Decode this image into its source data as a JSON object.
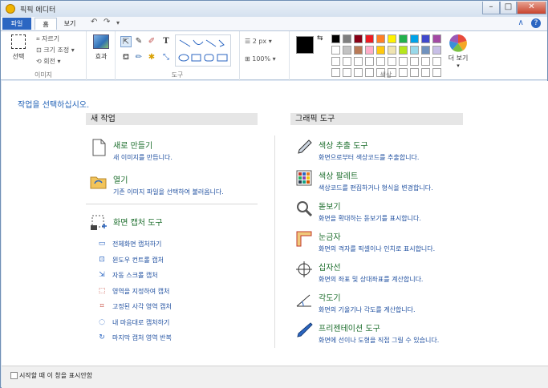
{
  "window": {
    "title": "픽픽 에디터",
    "min": "–",
    "max": "□",
    "close": "✕"
  },
  "menu": {
    "file": "파일",
    "home": "홈",
    "view": "보기",
    "undo": "↶",
    "redo": "↷",
    "qat_more": "▾",
    "help_min": "∧",
    "help": "?"
  },
  "ribbon": {
    "select": {
      "label": "선택",
      "crop": "자르기",
      "resize": "크기 조정",
      "rotate": "회전",
      "group": "이미지"
    },
    "effects": {
      "label": "효과"
    },
    "tools": {
      "group": "도구"
    },
    "size": {
      "value": "2 px",
      "zoom": "100%"
    },
    "color": {
      "more": "더 보기",
      "group": "색상"
    },
    "palette": [
      "#000000",
      "#7f7f7f",
      "#880015",
      "#ed1c24",
      "#ff7f27",
      "#fff200",
      "#22b14c",
      "#00a2e8",
      "#3f48cc",
      "#a349a4",
      "#ffffff",
      "#c3c3c3",
      "#b97a57",
      "#ffaec9",
      "#ffc90e",
      "#efe4b0",
      "#b5e61d",
      "#99d9ea",
      "#7092be",
      "#c8bfe7"
    ]
  },
  "content": {
    "prompt": "작업을 선택하십시오.",
    "new_work": {
      "header": "새 작업",
      "items": [
        {
          "title": "새로 만들기",
          "desc": "새 이미지를 만듭니다."
        },
        {
          "title": "열기",
          "desc": "기존 이미지 파일을 선택하여 불러옵니다."
        },
        {
          "title": "화면 캡처 도구",
          "desc": ""
        }
      ],
      "capture_items": [
        "전체화면 캡처하기",
        "윈도우 컨트롤 캡처",
        "자동 스크롤 캡처",
        "영역을 지정하여 캡처",
        "고정된 사각 영역 캡처",
        "내 마음대로 캡처하기",
        "마지막 캡처 영역 반복"
      ]
    },
    "graphic_tools": {
      "header": "그래픽 도구",
      "items": [
        {
          "title": "색상 추출 도구",
          "desc": "화면으로부터 색상코드를 추출합니다."
        },
        {
          "title": "색상 팔레트",
          "desc": "색상코드를 편집하거나 형식을 변경합니다."
        },
        {
          "title": "돋보기",
          "desc": "화면을 확대하는 돋보기를 표시합니다."
        },
        {
          "title": "눈금자",
          "desc": "화면의 격자를 픽셀이나 인치로 표시합니다."
        },
        {
          "title": "십자선",
          "desc": "화면의 좌표 및 상대좌표를 계산합니다."
        },
        {
          "title": "각도기",
          "desc": "화면의 기울기나 각도를 계산합니다."
        },
        {
          "title": "프리젠테이션 도구",
          "desc": "화면에 선이나 도형을 직접 그릴 수 있습니다."
        }
      ]
    }
  },
  "status": {
    "startup_checkbox": "시작할 때 이 창을 표시안함"
  }
}
